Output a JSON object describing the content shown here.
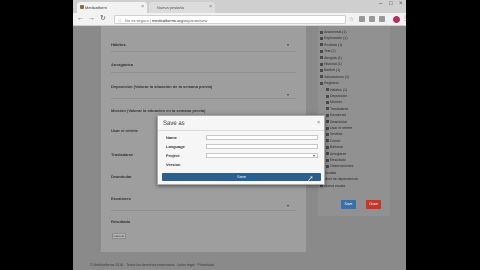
{
  "browser": {
    "tabs": [
      {
        "label": "Medicalform",
        "active": true
      },
      {
        "label": "Nueva pestaña",
        "active": false
      }
    ],
    "url": {
      "prefix": "No es seguro",
      "host": "medicalforms.org",
      "path": "/aspanas/new"
    },
    "profile_initial": "B"
  },
  "form": {
    "fields": [
      {
        "label": "Hábitos"
      },
      {
        "label": "Anorgánica"
      },
      {
        "label": "Deposición (Valorar la situación de la semana previa)"
      },
      {
        "label": "Micción (Valorar la situación en la semana previa)"
      },
      {
        "label": "Usar el retrete"
      },
      {
        "label": "Trasladarse"
      },
      {
        "label": "Deambular"
      },
      {
        "label": "Escalones"
      },
      {
        "label": "Resultado"
      }
    ],
    "small_button": "Calcular"
  },
  "sidebar": {
    "items": [
      "Anamnesis (1)",
      "Exploración (1)",
      "Pruebas (1)",
      "Test (2)",
      "Alergias (1)",
      "Historial (1)",
      "Barthel (1)",
      "Valoraciones (2)",
      "Registros",
      "Hábitos (1)",
      "Deposición",
      "Micción",
      "Trasladarse",
      "Escalones",
      "Deambular",
      "Usar el retrete",
      "Vestirse",
      "Comer",
      "Bañarse",
      "Arreglarse",
      "Resultado",
      "Observaciones",
      "Escalas",
      "Nivel de dependencia",
      "Nueva escala"
    ],
    "save_label": "Save",
    "cancel_label": "Close"
  },
  "footer": {
    "text": "© Medicalforms 2016 · Todos los derechos reservados · Aviso legal · Privacidad"
  },
  "modal": {
    "title": "Save as",
    "close": "×",
    "labels": {
      "name": "Name",
      "language": "Language",
      "project": "Project",
      "version": "Version"
    },
    "save_button": "Save"
  },
  "colors": {
    "accent": "#2e5f8a",
    "save_btn": "#3b6fa8",
    "close_btn": "#c0392b"
  }
}
